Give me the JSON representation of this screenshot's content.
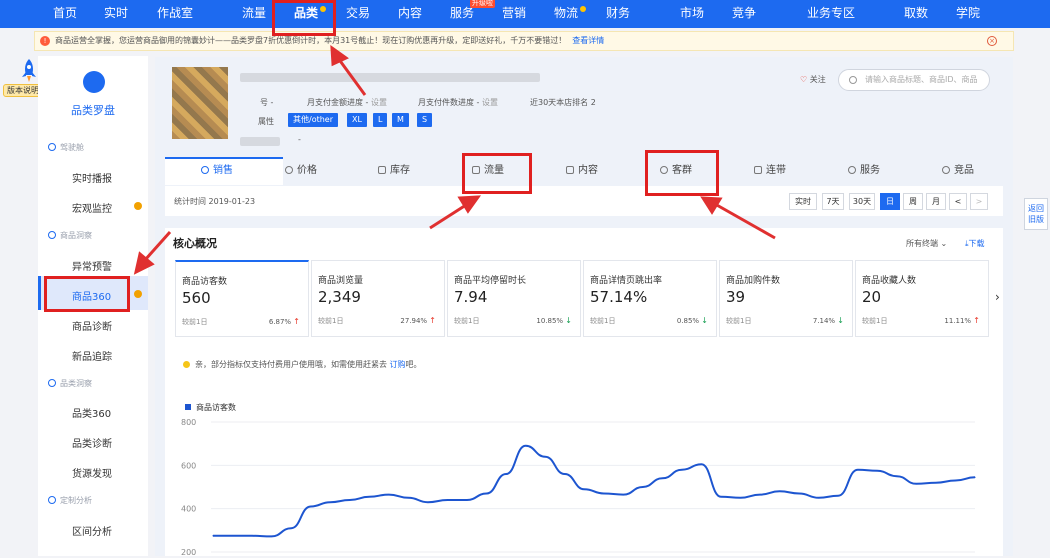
{
  "topnav": {
    "items": [
      "首页",
      "实时",
      "作战室",
      "流量",
      "品类",
      "交易",
      "内容",
      "服务",
      "营销",
      "物流",
      "财务",
      "市场",
      "竞争",
      "业务专区",
      "取数",
      "学院"
    ],
    "badge": "升级啦",
    "active": "品类"
  },
  "notice": {
    "text": "商品运营全掌握，您运营商品御用的锦囊妙计——品类罗盘7折优惠倒计时，本月31号截止！现在订购优惠再升级，定即送好礼，千万不要错过！",
    "link": "查看详情"
  },
  "version_tag": "版本说明",
  "sidebar": {
    "title": "品类罗盘",
    "sections": [
      {
        "label": "驾驶舱",
        "items": [
          "实时播报",
          "宏观监控"
        ]
      },
      {
        "label": "商品洞察",
        "items": [
          "异常预警",
          "商品360",
          "商品诊断",
          "新品追踪"
        ]
      },
      {
        "label": "品类洞察",
        "items": [
          "品类360",
          "品类诊断",
          "货源发现"
        ]
      },
      {
        "label": "定制分析",
        "items": [
          "区间分析"
        ]
      }
    ],
    "active": "商品360"
  },
  "product": {
    "row1": {
      "id_label": "号 -",
      "pay_progress": "月支付金额进度 -",
      "pay_link": "设置",
      "pieces_progress": "月支付件数进度 -",
      "pieces_link": "设置",
      "rank": "近30天本店排名 2"
    },
    "attr_label": "属性",
    "attrs": [
      "其他/other",
      "XL",
      "L",
      "M",
      "S"
    ],
    "dash": "-"
  },
  "follow": "关注",
  "search": {
    "placeholder": "请输入商品标题、商品ID、商品"
  },
  "tabs": [
    "销售",
    "价格",
    "库存",
    "流量",
    "内容",
    "客群",
    "连带",
    "服务",
    "竞品"
  ],
  "stat": {
    "time_label": "统计时间 2019-01-23",
    "buttons": [
      "实时",
      "7天",
      "30天",
      "日",
      "周",
      "月",
      "<",
      ">"
    ],
    "active": "日"
  },
  "core": {
    "title": "核心概况",
    "filter": "所有终端",
    "download": "下载",
    "compare_label": "较前1日",
    "metrics": [
      {
        "label": "商品访客数",
        "value": "560",
        "pct": "6.87%",
        "dir": "up"
      },
      {
        "label": "商品浏览量",
        "value": "2,349",
        "pct": "27.94%",
        "dir": "up"
      },
      {
        "label": "商品平均停留时长",
        "value": "7.94",
        "pct": "10.85%",
        "dir": "down"
      },
      {
        "label": "商品详情页跳出率",
        "value": "57.14%",
        "pct": "0.85%",
        "dir": "down"
      },
      {
        "label": "商品加购件数",
        "value": "39",
        "pct": "7.14%",
        "dir": "down"
      },
      {
        "label": "商品收藏人数",
        "value": "20",
        "pct": "11.11%",
        "dir": "up"
      }
    ],
    "hint": {
      "text": "亲，部分指标仅支持付费用户使用哦，如需使用赶紧去",
      "link": "订购",
      "end": "吧。"
    }
  },
  "chart_data": {
    "type": "line",
    "series": [
      {
        "name": "商品访客数",
        "values": [
          275,
          275,
          275,
          272,
          310,
          410,
          430,
          440,
          455,
          465,
          450,
          430,
          440,
          440,
          470,
          560,
          690,
          640,
          560,
          490,
          470,
          465,
          500,
          540,
          580,
          605,
          455,
          450,
          465,
          480,
          470,
          450,
          460,
          580,
          575,
          550,
          515,
          520,
          530,
          545
        ]
      }
    ],
    "yticks": [
      "800",
      "600",
      "400",
      "200"
    ],
    "ylim": [
      200,
      800
    ],
    "color": "#1d55d0"
  },
  "side_back": {
    "line1": "返回",
    "line2": "旧版"
  }
}
